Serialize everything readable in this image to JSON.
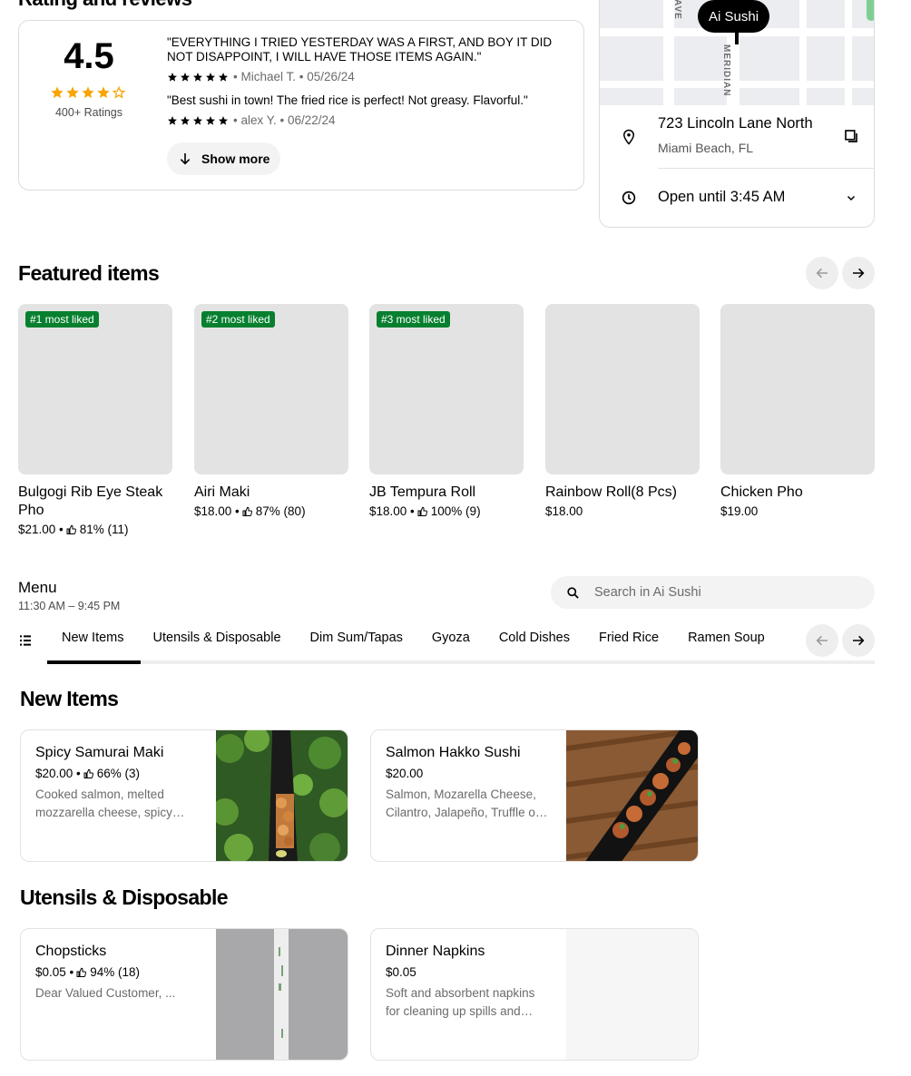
{
  "rating": {
    "section_title": "Rating and reviews",
    "score": "4.5",
    "stars_filled": 4,
    "stars_total": 5,
    "count_label": "400+ Ratings",
    "reviews": [
      {
        "text": "\"EVERYTHING I TRIED YESTERDAY WAS A FIRST, AND BOY IT DID NOT DISAPPOINT, I WILL HAVE THOSE ITEMS AGAIN.\"",
        "meta": "• Michael T. • 05/26/24"
      },
      {
        "text": "\"Best sushi in town! The fried rice is perfect! Not greasy. Flavorful.\"",
        "meta": "• alex Y. • 06/22/24"
      }
    ],
    "show_more": "Show more"
  },
  "location": {
    "map_label": "Ai Sushi",
    "street_1": "AVE",
    "street_2": "MERIDIAN",
    "address": "723 Lincoln Lane North",
    "city": "Miami Beach, FL",
    "hours": "Open until 3:45 AM"
  },
  "featured": {
    "title": "Featured items",
    "items": [
      {
        "badge": "#1 most liked",
        "name": "Bulgogi Rib Eye Steak Pho",
        "price": "$21.00 •",
        "rating": "81% (11)"
      },
      {
        "badge": "#2 most liked",
        "name": "Airi Maki",
        "price": "$18.00 •",
        "rating": "87% (80)"
      },
      {
        "badge": "#3 most liked",
        "name": "JB Tempura Roll",
        "price": "$18.00 •",
        "rating": "100% (9)"
      },
      {
        "badge": "",
        "name": "Rainbow Roll(8 Pcs)",
        "price": "$18.00",
        "rating": ""
      },
      {
        "badge": "",
        "name": "Chicken Pho",
        "price": "$19.00",
        "rating": ""
      }
    ]
  },
  "menu": {
    "title": "Menu",
    "hours": "11:30 AM – 9:45 PM",
    "search_placeholder": "Search in Ai Sushi",
    "tabs": [
      "New Items",
      "Utensils & Disposable",
      "Dim Sum/Tapas",
      "Gyoza",
      "Cold Dishes",
      "Fried Rice",
      "Ramen Soup"
    ],
    "active_tab": "New Items"
  },
  "sections": [
    {
      "title": "New Items",
      "items": [
        {
          "name": "Spicy Samurai Maki",
          "price": "$20.00 •",
          "rating": "66% (3)",
          "desc": "Cooked salmon, melted mozzarella cheese, spicy mayo, eel sauce"
        },
        {
          "name": "Salmon Hakko Sushi",
          "price": "$20.00",
          "rating": "",
          "desc": "Salmon, Mozarella Cheese, Cilantro, Jalapeño, Truffle oil, eel sauce"
        }
      ]
    },
    {
      "title": "Utensils & Disposable",
      "items": [
        {
          "name": "Chopsticks",
          "price": "$0.05 •",
          "rating": "94% (18)",
          "desc": "Dear Valued Customer, ..."
        },
        {
          "name": "Dinner Napkins",
          "price": "$0.05",
          "rating": "",
          "desc": "Soft and absorbent napkins for cleaning up spills and messes"
        }
      ]
    }
  ],
  "colors": {
    "badge_green": "#06802f",
    "star": "#000000",
    "score_star": "#f6a609",
    "muted_text": "#6b6b6b"
  }
}
